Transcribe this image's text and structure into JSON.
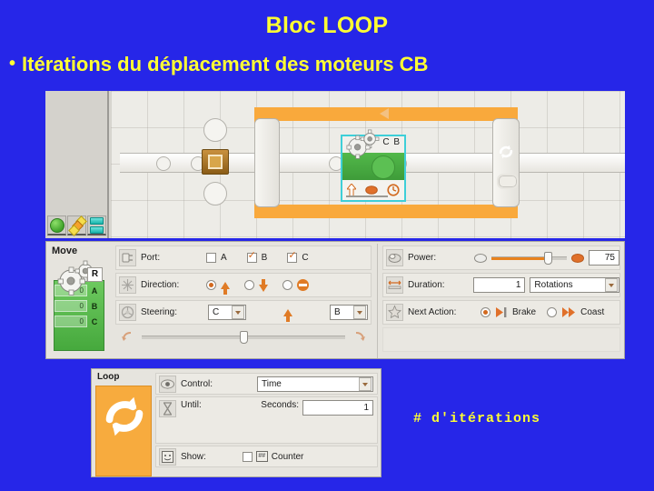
{
  "slide": {
    "title": "Bloc LOOP",
    "bullet_marker": "•",
    "bullet_text": "Itérations du déplacement des moteurs CB",
    "annotation": "# d'itérations",
    "colors": {
      "background": "#2626e8",
      "text": "#ffff33",
      "accent_orange": "#f9a93c",
      "move_green": "#46a93d",
      "select_cyan": "#3ecfd8"
    }
  },
  "canvas": {
    "palette_tabs": [
      {
        "name": "common-palette",
        "icon": "green-circle-icon"
      },
      {
        "name": "complete-palette",
        "icon": "diamonds-icon"
      },
      {
        "name": "custom-palette",
        "icon": "bars-icon"
      }
    ],
    "start_block": {
      "icon": "start-block-icon"
    },
    "loop_block": {
      "icon_cycle": "loop-cycle-icon",
      "icon_infinite": "infinity-icon"
    },
    "move_block": {
      "label": "C B",
      "icon": "gears-icon",
      "selected": true
    }
  },
  "move_panel": {
    "title": "Move",
    "block_icon": {
      "header": "R",
      "rows": [
        {
          "value": "0",
          "port": "A"
        },
        {
          "value": "0",
          "port": "B"
        },
        {
          "value": "0",
          "port": "C"
        }
      ]
    },
    "port": {
      "label": "Port:",
      "icon": "port-icon",
      "options": [
        {
          "label": "A",
          "checked": false
        },
        {
          "label": "B",
          "checked": true
        },
        {
          "label": "C",
          "checked": true
        }
      ]
    },
    "direction": {
      "label": "Direction:",
      "icon": "direction-icon",
      "options": [
        {
          "icon": "arrow-up-icon",
          "checked": true
        },
        {
          "icon": "arrow-down-icon",
          "checked": false
        },
        {
          "icon": "stop-icon",
          "checked": false
        }
      ]
    },
    "steering": {
      "label": "Steering:",
      "icon": "steering-icon",
      "left_motor": "C",
      "center_icon": "arrow-up-icon",
      "right_motor": "B",
      "slider_value": 50,
      "left_end_icon": "turn-left-icon",
      "right_end_icon": "turn-right-icon"
    },
    "power": {
      "label": "Power:",
      "icon": "power-icon",
      "value": "75",
      "slider_percent": 75,
      "low_icon": "power-low-icon",
      "high_icon": "power-high-icon"
    },
    "duration": {
      "label": "Duration:",
      "icon": "duration-icon",
      "value": "1",
      "unit": "Rotations"
    },
    "next_action": {
      "label": "Next Action:",
      "icon": "next-action-icon",
      "options": [
        {
          "label": "Brake",
          "icon": "brake-icon",
          "checked": true
        },
        {
          "label": "Coast",
          "icon": "coast-icon",
          "checked": false
        }
      ]
    }
  },
  "loop_panel": {
    "title": "Loop",
    "block_icon": "loop-cycle-icon",
    "control": {
      "label": "Control:",
      "icon": "control-icon",
      "value": "Time"
    },
    "until": {
      "label": "Until:",
      "icon": "hourglass-icon",
      "seconds_label": "Seconds:",
      "seconds_value": "1"
    },
    "show": {
      "label": "Show:",
      "icon": "show-icon",
      "counter_label": "Counter",
      "counter_checked": false
    }
  }
}
